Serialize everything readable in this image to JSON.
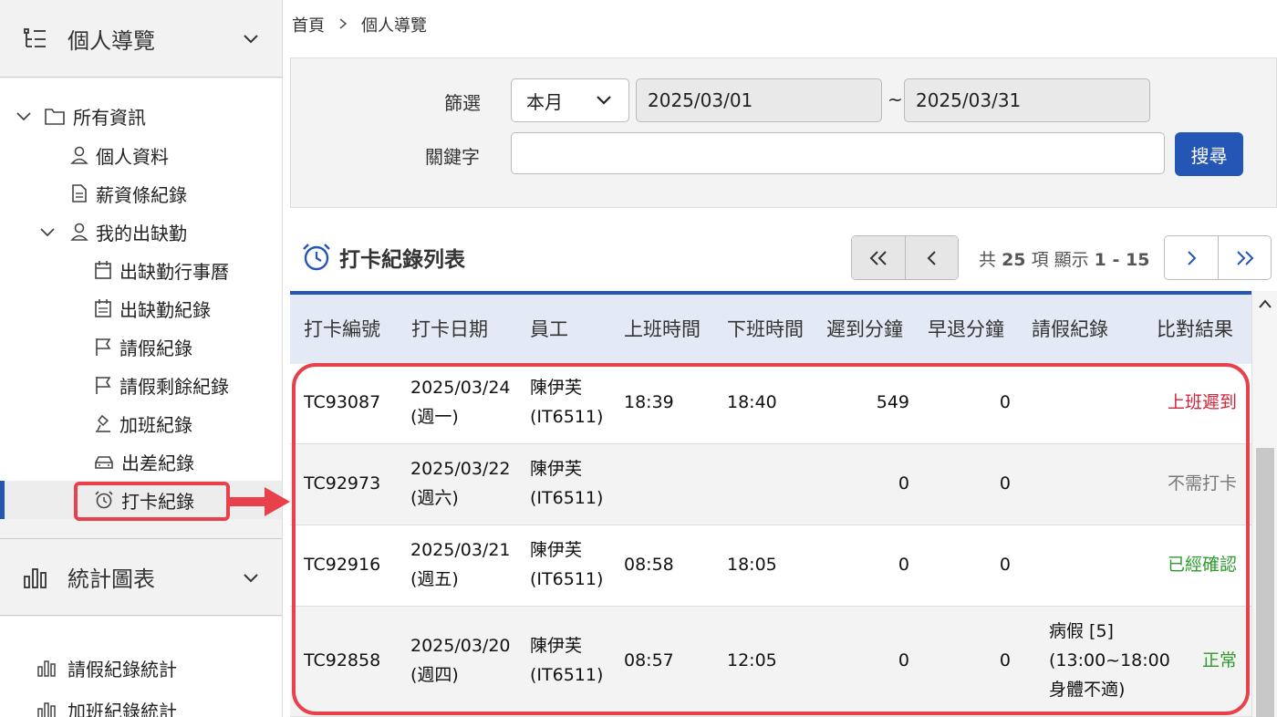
{
  "sidebar": {
    "section1_title": "個人導覽",
    "tree": {
      "root": "所有資訊",
      "personal": "個人資料",
      "salary": "薪資條紀錄",
      "attendance_group": "我的出缺勤",
      "calendar": "出缺勤行事曆",
      "attendance_record": "出缺勤紀錄",
      "leave": "請假紀錄",
      "leave_remaining": "請假剩餘紀錄",
      "overtime": "加班紀錄",
      "business_trip": "出差紀錄",
      "punch": "打卡紀錄"
    },
    "section2_title": "統計圖表",
    "stats": [
      "請假紀錄統計",
      "加班紀錄統計"
    ]
  },
  "breadcrumb": {
    "home": "首頁",
    "current": "個人導覽"
  },
  "filter": {
    "filter_label": "篩選",
    "period": "本月",
    "start_date": "2025/03/01",
    "tilde": "~",
    "end_date": "2025/03/31",
    "keyword_label": "關鍵字",
    "keyword_value": "",
    "search_button": "搜尋"
  },
  "list": {
    "title": "打卡紀錄列表",
    "pager": {
      "prefix": "共",
      "total": "25",
      "mid": "項 顯示",
      "range": "1 - 15"
    }
  },
  "table": {
    "headers": [
      "打卡編號",
      "打卡日期",
      "員工",
      "上班時間",
      "下班時間",
      "遲到分鐘",
      "早退分鐘",
      "請假紀錄",
      "比對結果"
    ],
    "rows": [
      {
        "id": "TC93087",
        "date": "2025/03/24",
        "weekday": "(週一)",
        "emp_name": "陳伊芙",
        "emp_id": "(IT6511)",
        "clock_in": "18:39",
        "clock_out": "18:40",
        "late": "549",
        "early": "0",
        "leave_l1": "",
        "leave_l2": "",
        "leave_l3": "",
        "result": "上班遲到",
        "result_color": "#d4223a"
      },
      {
        "id": "TC92973",
        "date": "2025/03/22",
        "weekday": "(週六)",
        "emp_name": "陳伊芙",
        "emp_id": "(IT6511)",
        "clock_in": "",
        "clock_out": "",
        "late": "0",
        "early": "0",
        "leave_l1": "",
        "leave_l2": "",
        "leave_l3": "",
        "result": "不需打卡",
        "result_color": "#777777"
      },
      {
        "id": "TC92916",
        "date": "2025/03/21",
        "weekday": "(週五)",
        "emp_name": "陳伊芙",
        "emp_id": "(IT6511)",
        "clock_in": "08:58",
        "clock_out": "18:05",
        "late": "0",
        "early": "0",
        "leave_l1": "",
        "leave_l2": "",
        "leave_l3": "",
        "result": "已經確認",
        "result_color": "#2e9a2e"
      },
      {
        "id": "TC92858",
        "date": "2025/03/20",
        "weekday": "(週四)",
        "emp_name": "陳伊芙",
        "emp_id": "(IT6511)",
        "clock_in": "08:57",
        "clock_out": "12:05",
        "late": "0",
        "early": "0",
        "leave_l1": "病假 [5]",
        "leave_l2": "(13:00~18:00",
        "leave_l3": "身體不適)",
        "result": "正常",
        "result_color": "#2e9a2e"
      }
    ]
  }
}
